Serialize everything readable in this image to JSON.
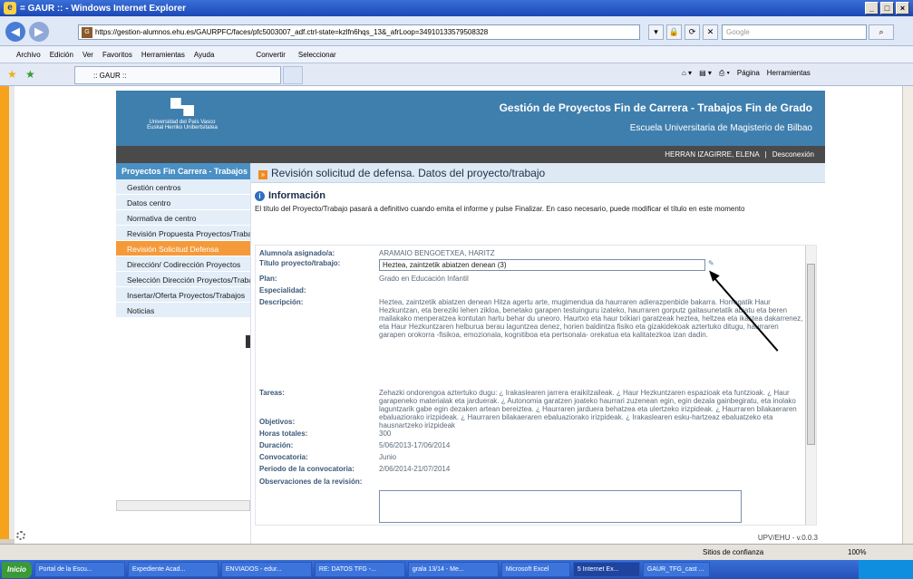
{
  "window": {
    "title": "= GAUR :: - Windows Internet Explorer",
    "controls": [
      "_",
      "□",
      "×"
    ]
  },
  "address": {
    "url": "https://gestion-alumnos.ehu.es/GAURPFC/faces/pfc5003007_adf.ctrl-state=kzlfn6hqs_13&_afrLoop=34910133579508328",
    "search_placeholder": "Google"
  },
  "menu": {
    "items": [
      "Archivo",
      "Edición",
      "Ver",
      "Favoritos",
      "Herramientas",
      "Ayuda"
    ],
    "convertir": "Convertir",
    "seleccionar": "Seleccionar"
  },
  "tab": {
    "title": ":: GAUR ::"
  },
  "commandbar": {
    "pagina": "Página",
    "herramientas": "Herramientas"
  },
  "banner": {
    "logo_line1": "Universidad del País Vasco",
    "logo_line2": "Euskal Herriko Unibertsitatea",
    "title": "Gestión de Proyectos Fin de Carrera - Trabajos Fin de Grado",
    "subtitle": "Escuela Universitaria de Magisterio de Bilbao"
  },
  "userbar": {
    "user": "HERRAN IZAGIRRE, ELENA",
    "sep": "|",
    "logout": "Desconexión"
  },
  "sidebar": {
    "header": "Proyectos Fin Carrera - Trabajos Fin de Grado",
    "items": [
      "Gestión centros",
      "Datos centro",
      "Normativa de centro",
      "Revisión Propuesta Proyectos/Trabajos",
      "Revisión Solicitud Defensa",
      "Dirección/ Codirección Proyectos",
      "Selección Dirección Proyectos/Trabajos",
      "Insertar/Oferta Proyectos/Trabajos",
      "Noticias"
    ]
  },
  "page": {
    "title": "Revisión solicitud de defensa. Datos del proyecto/trabajo",
    "info_heading": "Información",
    "info_text": "El título del Proyecto/Trabajo pasará a definitivo cuando emita el informe y pulse Finalizar. En caso necesario, puede modificar el título en este momento"
  },
  "form": {
    "alumno_label": "Alumno/a asignado/a:",
    "alumno": "ARAMAIO BENGOETXEA, HARITZ",
    "titulo_label": "Título proyecto/trabajo:",
    "titulo": "Heztea, zaintzetik abiatzen denean (3)",
    "plan_label": "Plan:",
    "plan": "Grado en Educación Infantil",
    "especialidad_label": "Especialidad:",
    "especialidad": "",
    "descripcion_label": "Descripción:",
    "descripcion": "Heztea, zaintzetik abiatzen denean Hitza agertu arte, mugimendua da haurraren adierazpenbide bakarra. Horregatik Haur Hezkuntzan, eta bereziki lehen zikloa, benetako garapen testuinguru izateko, haurraren gorputz gaitasunetatik abiatu eta beren mailakako menperatzea kontutan hartu behar du uneoro. Haurtxo eta haur txikiari garatzeak heztea, heltzea eta ikastea dakarrenez, eta Haur Hezkuntzaren helburua berau laguntzea denez, horien baldintza fisiko eta gizakidekoak aztertuko ditugu, haurraren garapen orokorra -fisikoa, emozionala, kognitiboa eta pertsonala- orekatua eta kalitatezkoa izan dadin.",
    "tareas_label": "Tareas:",
    "tareas": "Zehazki ondorengoa aztertuko dugu: ¿ Irakaslearen jarrera eraikitzaileak. ¿ Haur Hezkuntzaren espazioak eta funtzioak. ¿ Haur garapeneko materialak eta jarduerak. ¿ Autonomia garatzen joateko haurrari zuzenean egin, egin dezala gainbegiratu, eta inolako laguntzarik gabe egin dezaken artean bereiztea. ¿ Haurraren jarduera behatzea eta ulertzeko irizpideak. ¿ Haurraren bilakaeraren ebaluaziorako irizpideak. ¿ Haurraren bilakaeraren ebaluaziorako irizpideak. ¿ Irakaslearen esku-hartzeaz ebaluatzeko eta hausnartzeko irizpideak",
    "objetivos_label": "Objetivos:",
    "objetivos": "",
    "horas_label": "Horas totales:",
    "horas": "300",
    "duracion_label": "Duración:",
    "duracion": "5/06/2013-17/06/2014",
    "convocatoria_label": "Convocatoria:",
    "convocatoria": "Junio",
    "periodo_label": "Periodo de la convocatoria:",
    "periodo": "2/06/2014-21/07/2014",
    "observaciones_label": "Observaciones de la revisión:"
  },
  "footer": {
    "version": "UPV/EHU - v.0.0.3"
  },
  "status": {
    "zone": "Sitios de confianza",
    "zoom": "100%"
  },
  "taskbar": {
    "start": "Inicio",
    "items": [
      "Portal de la Escu...",
      "Expediente Acad...",
      "ENVIADOS - edur...",
      "RE: DATOS TFG -...",
      "grala 13/14 - Me...",
      "Microsoft Excel",
      "5 Internet Ex...",
      "GAUR_TFG_cast ..."
    ]
  }
}
